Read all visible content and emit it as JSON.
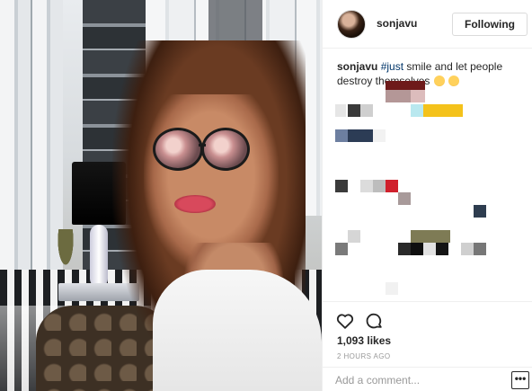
{
  "post": {
    "username": "sonjavu",
    "follow_label": "Following",
    "caption_user": "sonjavu",
    "caption_hashtag": "#just",
    "caption_text": " smile and let people destroy themselves",
    "likes": "1,093 likes",
    "timestamp": "2 HOURS AGO",
    "comment_placeholder": "Add a comment...",
    "more_label": "•••"
  },
  "icons": {
    "heart": "heart-icon",
    "comment": "comment-icon",
    "emoji": "smiling-emoji-icon"
  },
  "colors": {
    "hashtag": "#003569",
    "text": "#262626",
    "muted": "#999999",
    "divider": "#efefef"
  }
}
